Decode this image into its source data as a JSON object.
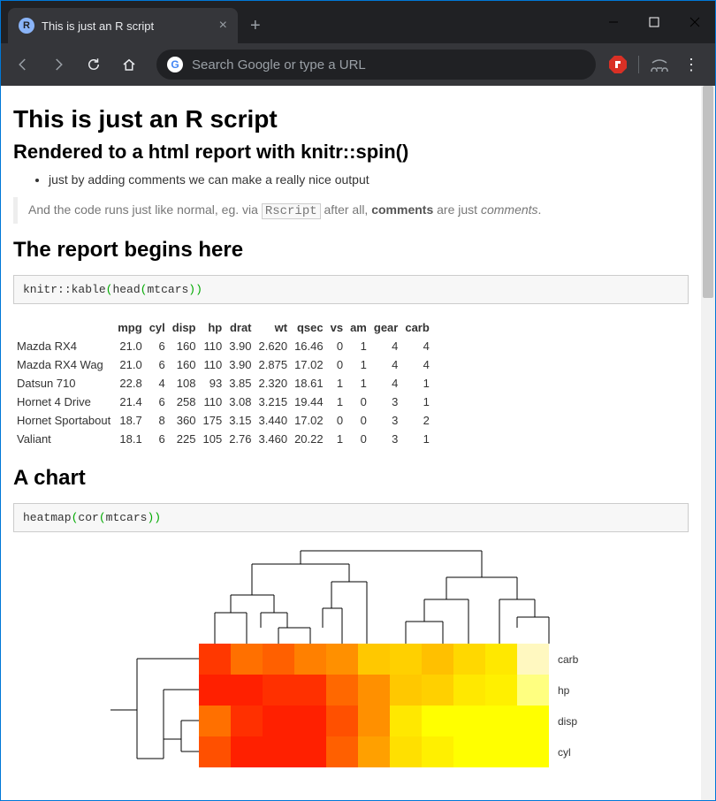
{
  "browser": {
    "tab_favicon_letter": "R",
    "tab_title": "This is just an R script",
    "omnibox_placeholder": "Search Google or type a URL"
  },
  "doc": {
    "h1": "This is just an R script",
    "h2": "Rendered to a html report with knitr::spin()",
    "bullet1": "just by adding comments we can make a really nice output",
    "blockquote_pre": "And the code runs just like normal, eg. via ",
    "blockquote_code": "Rscript",
    "blockquote_mid": " after all, ",
    "blockquote_strong": "comments",
    "blockquote_post": " are just ",
    "blockquote_em": "comments",
    "blockquote_end": ".",
    "sec1": "The report begins here",
    "code1": "knitr::kable(head(mtcars))",
    "sec2": "A chart",
    "code2": "heatmap(cor(mtcars))"
  },
  "table": {
    "headers": [
      "",
      "mpg",
      "cyl",
      "disp",
      "hp",
      "drat",
      "wt",
      "qsec",
      "vs",
      "am",
      "gear",
      "carb"
    ],
    "rows": [
      [
        "Mazda RX4",
        "21.0",
        "6",
        "160",
        "110",
        "3.90",
        "2.620",
        "16.46",
        "0",
        "1",
        "4",
        "4"
      ],
      [
        "Mazda RX4 Wag",
        "21.0",
        "6",
        "160",
        "110",
        "3.90",
        "2.875",
        "17.02",
        "0",
        "1",
        "4",
        "4"
      ],
      [
        "Datsun 710",
        "22.8",
        "4",
        "108",
        "93",
        "3.85",
        "2.320",
        "18.61",
        "1",
        "1",
        "4",
        "1"
      ],
      [
        "Hornet 4 Drive",
        "21.4",
        "6",
        "258",
        "110",
        "3.08",
        "3.215",
        "19.44",
        "1",
        "0",
        "3",
        "1"
      ],
      [
        "Hornet Sportabout",
        "18.7",
        "8",
        "360",
        "175",
        "3.15",
        "3.440",
        "17.02",
        "0",
        "0",
        "3",
        "2"
      ],
      [
        "Valiant",
        "18.1",
        "6",
        "225",
        "105",
        "2.76",
        "3.460",
        "20.22",
        "1",
        "0",
        "3",
        "1"
      ]
    ]
  },
  "chart_data": {
    "type": "heatmap",
    "title": "",
    "row_labels_visible": [
      "carb",
      "hp",
      "disp",
      "cyl"
    ],
    "col_count": 11,
    "row_count_visible": 4,
    "colors": [
      [
        "#ff3800",
        "#ff7000",
        "#ff6000",
        "#ff8000",
        "#ff9000",
        "#ffc800",
        "#ffd000",
        "#ffc000",
        "#ffd800",
        "#ffe800",
        "#fff8c0"
      ],
      [
        "#ff2000",
        "#ff2000",
        "#ff3000",
        "#ff3000",
        "#ff6800",
        "#ff9000",
        "#ffc800",
        "#ffd000",
        "#ffe800",
        "#fff000",
        "#ffff80"
      ],
      [
        "#ff7000",
        "#ff3000",
        "#ff2000",
        "#ff2000",
        "#ff5000",
        "#ff9000",
        "#ffe800",
        "#ffff00",
        "#ffff00",
        "#ffff00",
        "#ffff00"
      ],
      [
        "#ff5000",
        "#ff2000",
        "#ff2000",
        "#ff2000",
        "#ff6000",
        "#ffa000",
        "#ffe000",
        "#fff000",
        "#ffff00",
        "#ffff00",
        "#ffff00"
      ]
    ],
    "note": "Heatmap of cor(mtcars), only top portion visible in viewport"
  }
}
